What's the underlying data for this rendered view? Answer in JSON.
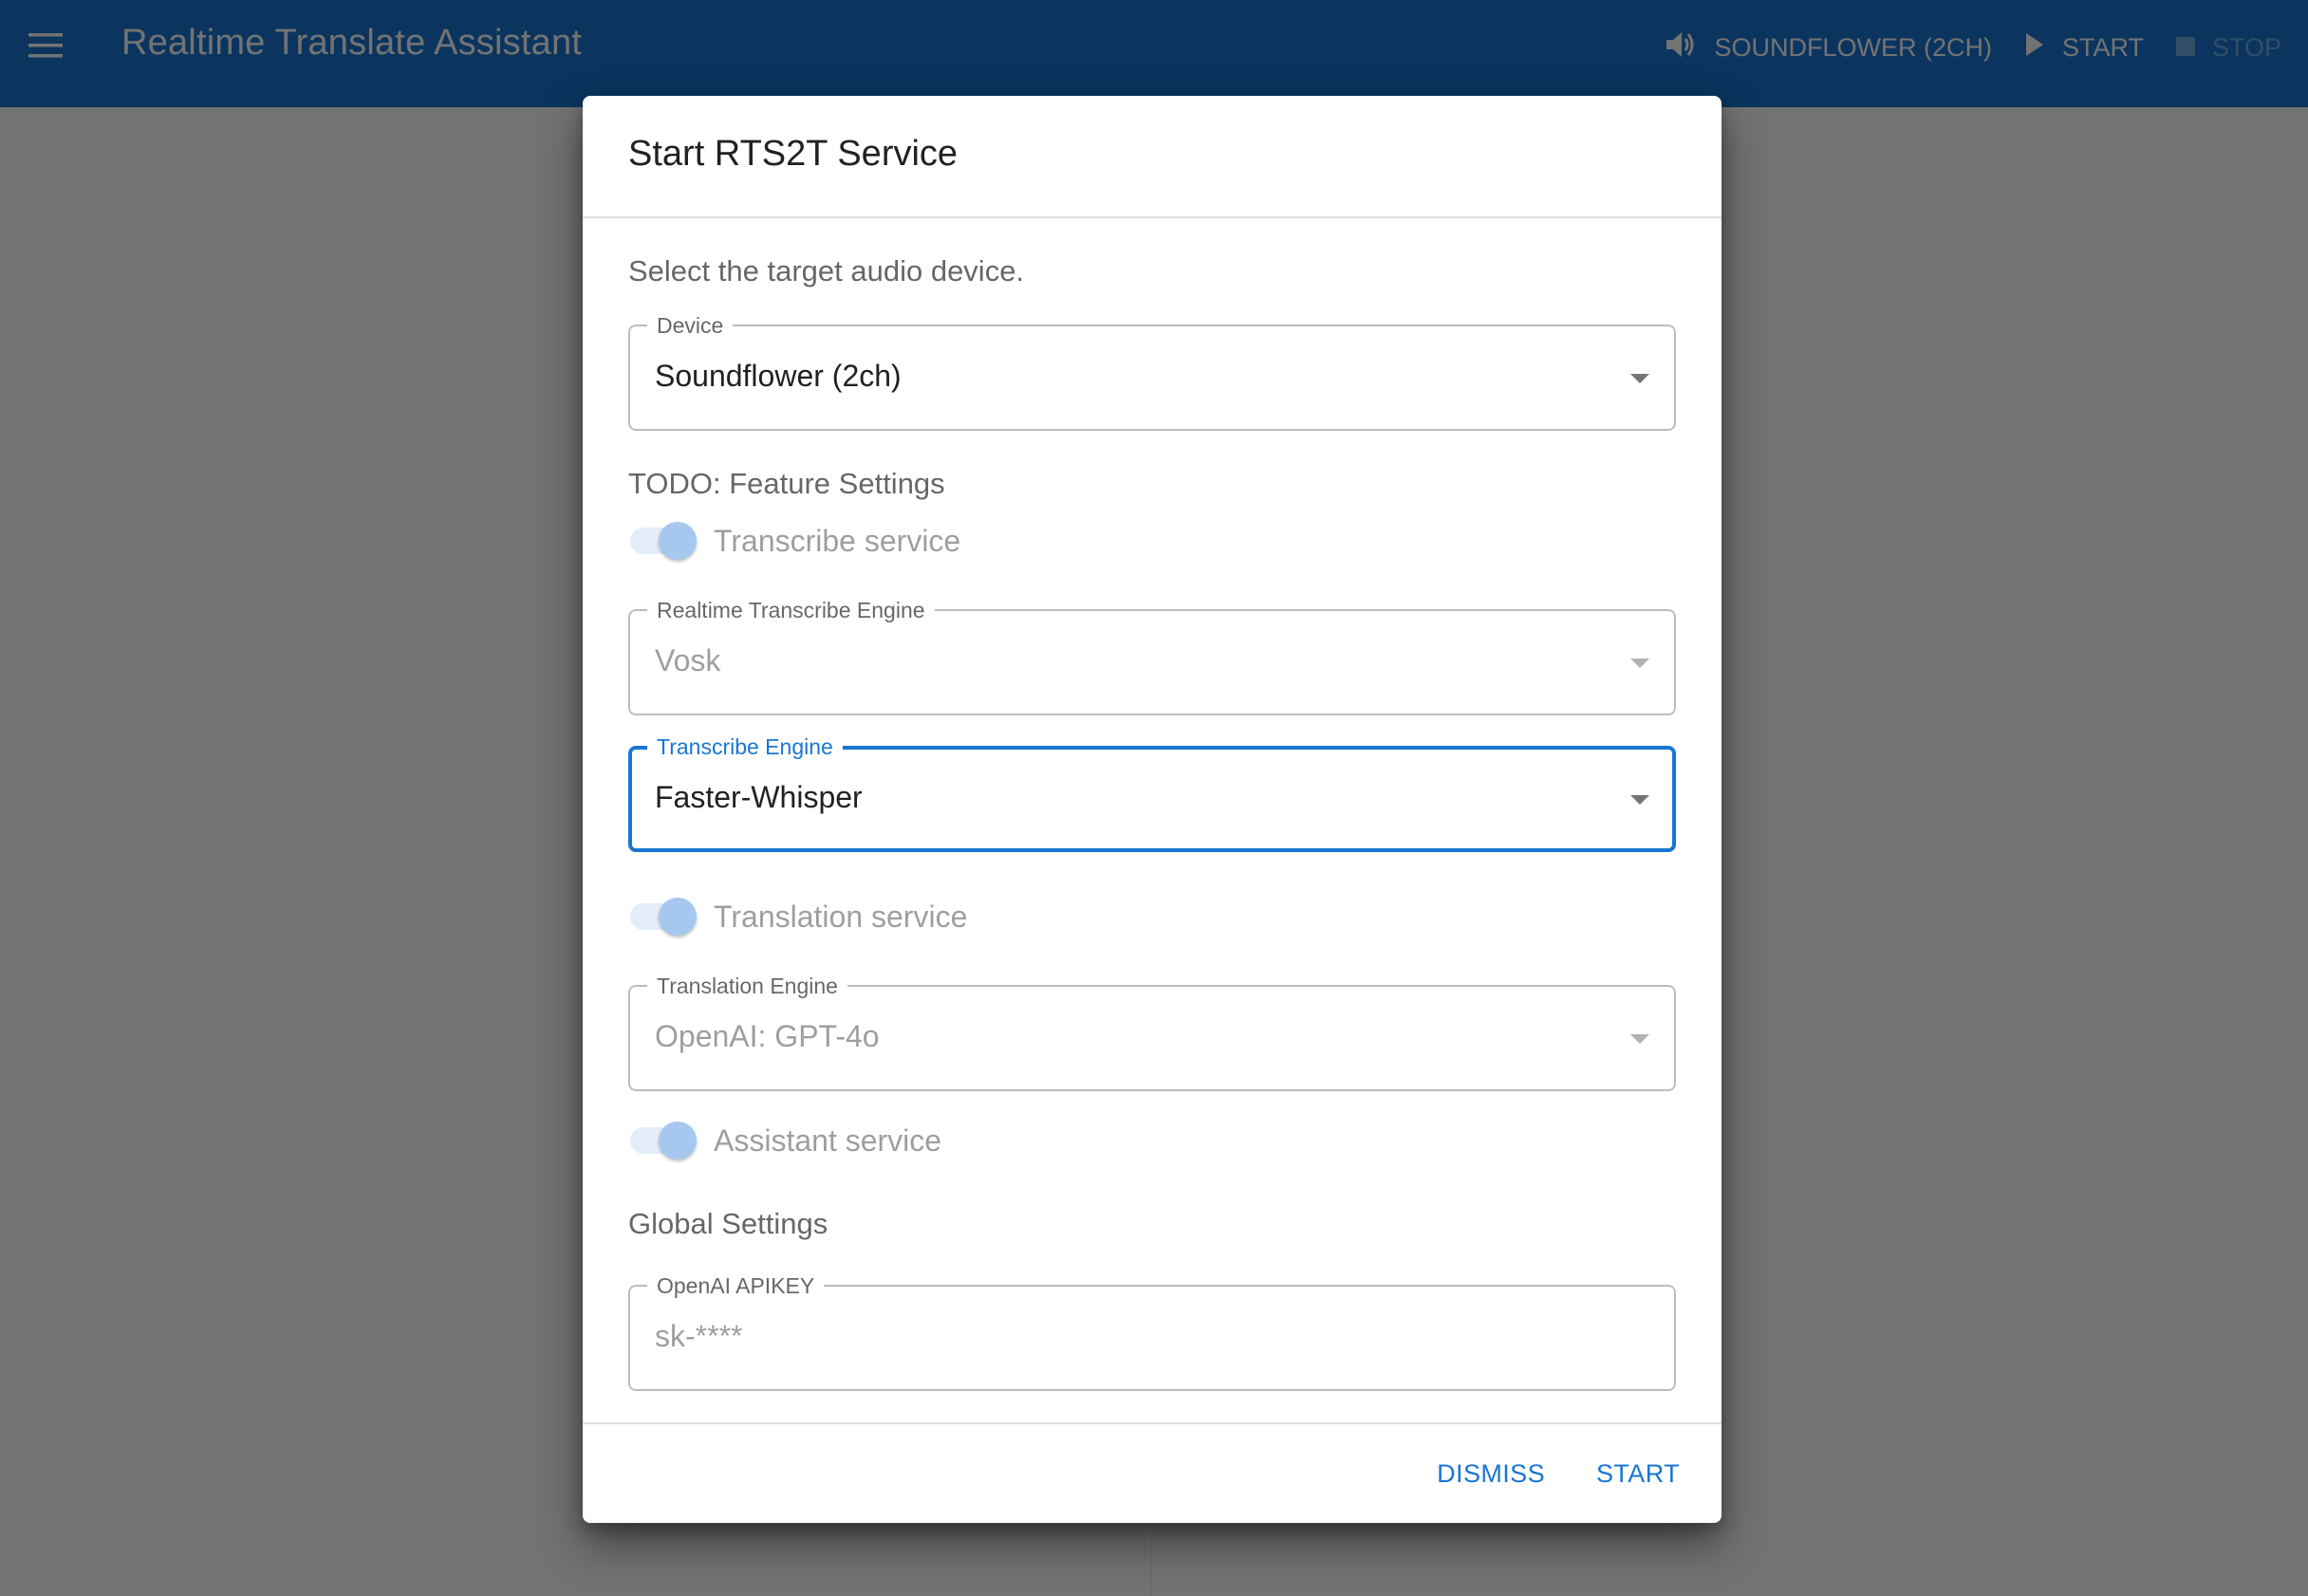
{
  "appbar": {
    "title": "Realtime Translate Assistant",
    "menu_icon": "hamburger-menu-icon",
    "device_label": "SOUNDFLOWER (2CH)",
    "device_icon": "speaker-volume-icon",
    "start_label": "START",
    "start_icon": "play-icon",
    "stop_label": "STOP",
    "stop_icon": "stop-icon",
    "stop_disabled": true
  },
  "dialog": {
    "title": "Start RTS2T Service",
    "instruction": "Select the target audio device.",
    "device_field": {
      "label": "Device",
      "value": "Soundflower (2ch)"
    },
    "feature_heading": "TODO: Feature Settings",
    "transcribe_switch": {
      "label": "Transcribe service",
      "checked": true,
      "disabled": true
    },
    "realtime_engine_field": {
      "label": "Realtime Transcribe Engine",
      "value": "Vosk",
      "disabled": true
    },
    "transcribe_engine_field": {
      "label": "Transcribe Engine",
      "value": "Faster-Whisper",
      "focused": true
    },
    "translation_switch": {
      "label": "Translation service",
      "checked": true,
      "disabled": true
    },
    "translation_engine_field": {
      "label": "Translation Engine",
      "value": "OpenAI: GPT-4o",
      "disabled": true
    },
    "assistant_switch": {
      "label": "Assistant service",
      "checked": true,
      "disabled": true
    },
    "global_heading": "Global Settings",
    "apikey_field": {
      "label": "OpenAI APIKEY",
      "placeholder": "sk-****",
      "value": ""
    },
    "dismiss_label": "DISMISS",
    "start_label": "START"
  },
  "colors": {
    "primary": "#1976d2",
    "switch_thumb_disabled": "#a6c8ee",
    "switch_track_disabled": "#e3edf9"
  }
}
